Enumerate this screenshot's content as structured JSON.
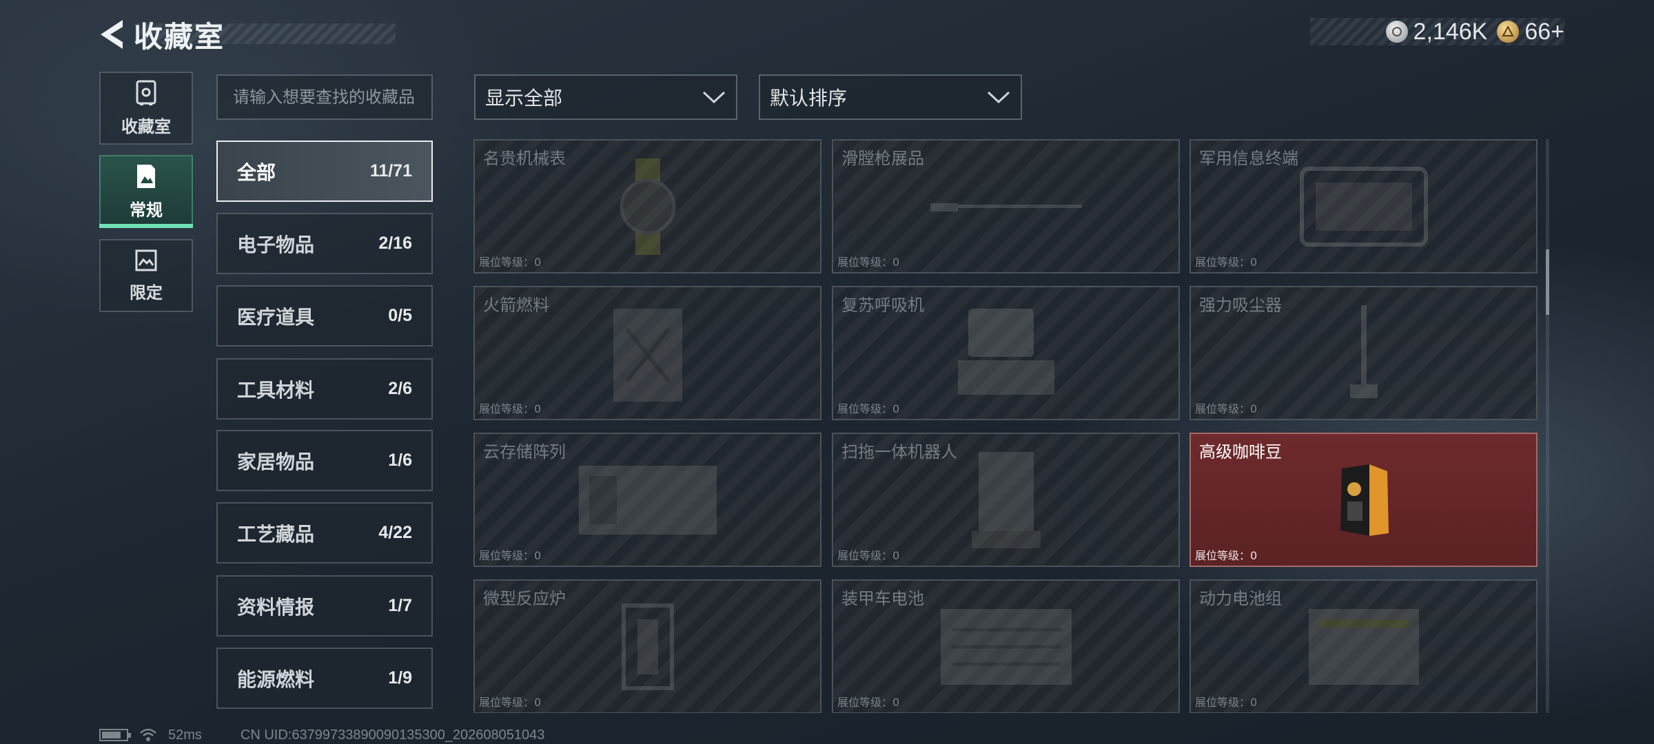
{
  "header": {
    "title": "收藏室",
    "currency": [
      {
        "icon": "silver-coin-icon",
        "value": "2,146K"
      },
      {
        "icon": "gold-coin-icon",
        "value": "66+"
      }
    ]
  },
  "side_tabs": [
    {
      "label": "收藏室",
      "icon": "safe-icon",
      "active": false
    },
    {
      "label": "常规",
      "icon": "photo-card-icon",
      "active": true
    },
    {
      "label": "限定",
      "icon": "landscape-card-icon",
      "active": false
    }
  ],
  "search": {
    "placeholder": "请输入想要查找的收藏品",
    "value": ""
  },
  "filters": {
    "display": "显示全部",
    "sort": "默认排序"
  },
  "categories": [
    {
      "name": "全部",
      "count": "11/71",
      "active": true
    },
    {
      "name": "电子物品",
      "count": "2/16"
    },
    {
      "name": "医疗道具",
      "count": "0/5"
    },
    {
      "name": "工具材料",
      "count": "2/6"
    },
    {
      "name": "家居物品",
      "count": "1/6"
    },
    {
      "name": "工艺藏品",
      "count": "4/22"
    },
    {
      "name": "资料情报",
      "count": "1/7"
    },
    {
      "name": "能源燃料",
      "count": "1/9"
    }
  ],
  "items": [
    {
      "name": "名贵机械表",
      "level": "展位等级：0",
      "icon": "watch-icon",
      "owned": false
    },
    {
      "name": "滑膛枪展品",
      "level": "展位等级：0",
      "icon": "musket-icon",
      "owned": false
    },
    {
      "name": "军用信息终端",
      "level": "展位等级：0",
      "icon": "terminal-case-icon",
      "owned": false
    },
    {
      "name": "火箭燃料",
      "level": "展位等级：0",
      "icon": "fuel-canister-icon",
      "owned": false
    },
    {
      "name": "复苏呼吸机",
      "level": "展位等级：0",
      "icon": "ventilator-icon",
      "owned": false
    },
    {
      "name": "强力吸尘器",
      "level": "展位等级：0",
      "icon": "vacuum-icon",
      "owned": false
    },
    {
      "name": "云存储阵列",
      "level": "展位等级：0",
      "icon": "storage-array-icon",
      "owned": false
    },
    {
      "name": "扫拖一体机器人",
      "level": "展位等级：0",
      "icon": "robot-vacuum-icon",
      "owned": false
    },
    {
      "name": "高级咖啡豆",
      "level": "展位等级：0",
      "icon": "coffee-bag-icon",
      "owned": true
    },
    {
      "name": "微型反应炉",
      "level": "展位等级：0",
      "icon": "reactor-icon",
      "owned": false
    },
    {
      "name": "装甲车电池",
      "level": "展位等级：0",
      "icon": "battery-pack-icon",
      "owned": false
    },
    {
      "name": "动力电池组",
      "level": "展位等级：0",
      "icon": "power-cell-icon",
      "owned": false
    }
  ],
  "status_bar": {
    "ping": "52ms",
    "uid": "CN UID:637997338900901353​00_202608051043"
  },
  "colors": {
    "accent": "#6fe0b4",
    "owned_card": "#6e2a2c"
  }
}
